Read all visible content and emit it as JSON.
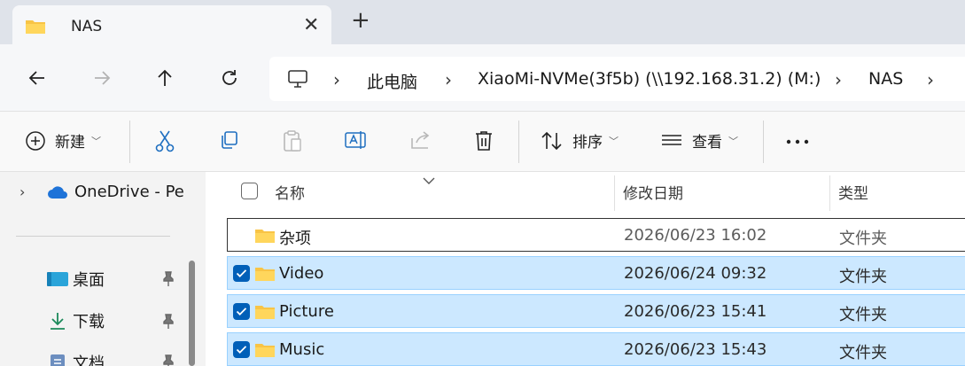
{
  "tab": {
    "title": "NAS"
  },
  "breadcrumb": [
    "此电脑",
    "XiaoMi-NVMe(3f5b) (\\\\192.168.31.2) (M:)",
    "NAS"
  ],
  "toolbar": {
    "new_label": "新建",
    "sort_label": "排序",
    "view_label": "查看"
  },
  "sidebar": {
    "onedrive": "OneDrive - Pe",
    "items": [
      {
        "label": "桌面"
      },
      {
        "label": "下载"
      },
      {
        "label": "文档"
      }
    ]
  },
  "columns": {
    "name": "名称",
    "modified": "修改日期",
    "type": "类型"
  },
  "rows": [
    {
      "name": "杂项",
      "modified": "2026/06/23 16:02",
      "type": "文件夹",
      "selected": false
    },
    {
      "name": "Video",
      "modified": "2026/06/24 09:32",
      "type": "文件夹",
      "selected": true
    },
    {
      "name": "Picture",
      "modified": "2026/06/23 15:41",
      "type": "文件夹",
      "selected": true
    },
    {
      "name": "Music",
      "modified": "2026/06/23 15:43",
      "type": "文件夹",
      "selected": true
    }
  ],
  "colors": {
    "accent": "#005fb8",
    "selection": "#cce8ff",
    "folder": "#f8c446"
  },
  "icons": [
    "folder-icon",
    "close-icon",
    "plus-icon",
    "back-arrow-icon",
    "forward-arrow-icon",
    "up-arrow-icon",
    "refresh-icon",
    "computer-icon",
    "cut-icon",
    "copy-icon",
    "paste-icon",
    "rename-icon",
    "share-icon",
    "delete-icon",
    "sort-icon",
    "view-icon",
    "more-icon",
    "onedrive-icon",
    "desktop-icon",
    "download-icon",
    "document-icon",
    "pin-icon"
  ]
}
